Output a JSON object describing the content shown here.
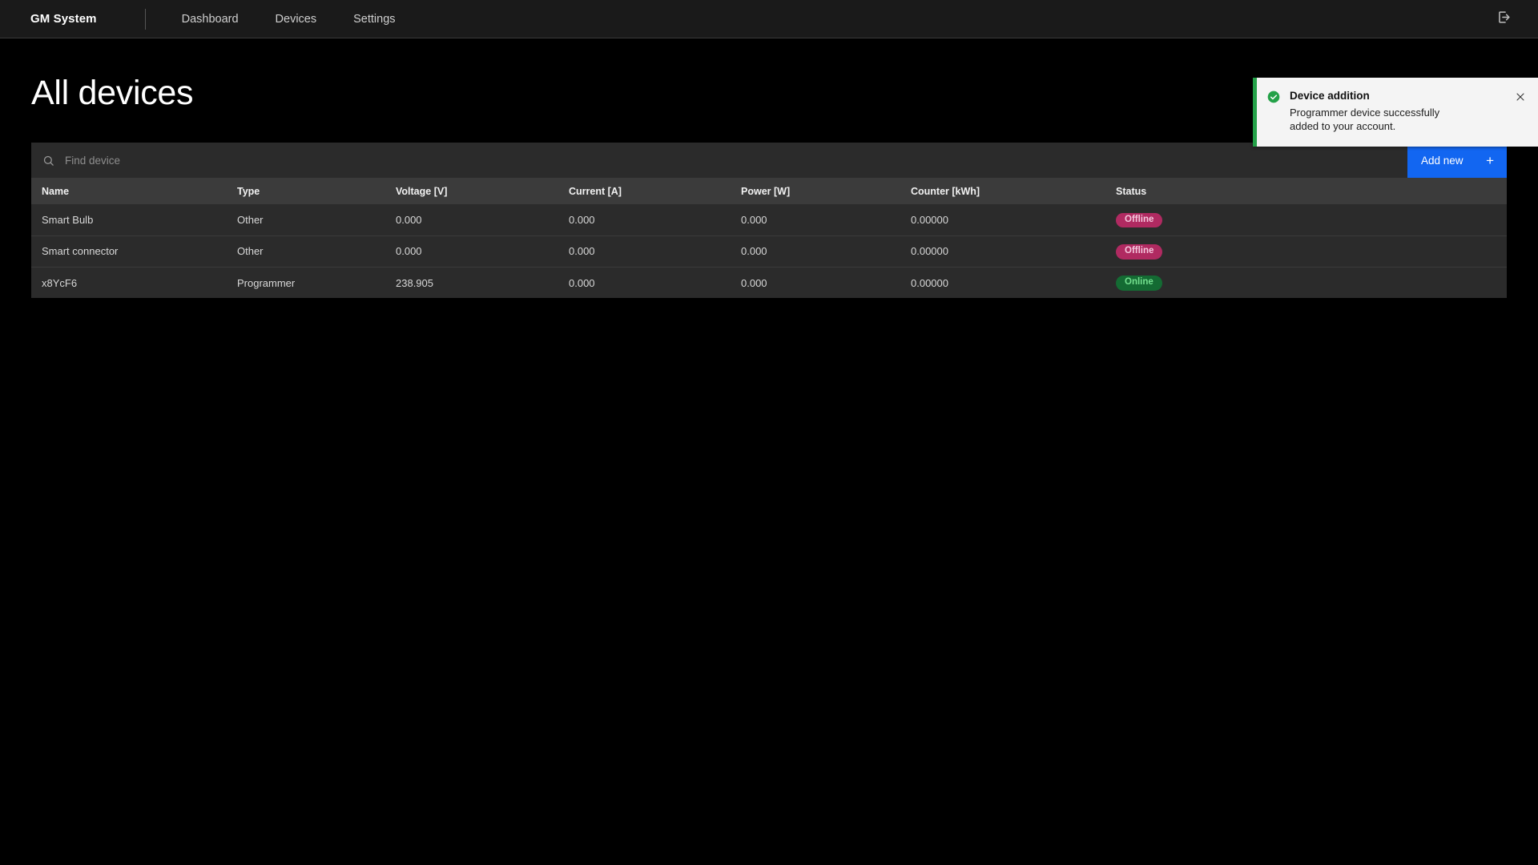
{
  "navbar": {
    "brand": "GM System",
    "links": [
      {
        "label": "Dashboard",
        "name": "nav-link-dashboard"
      },
      {
        "label": "Devices",
        "name": "nav-link-devices"
      },
      {
        "label": "Settings",
        "name": "nav-link-settings"
      }
    ],
    "logout_icon": "logout-icon"
  },
  "page": {
    "title": "All devices"
  },
  "toolbar": {
    "search_placeholder": "Find device",
    "search_value": "",
    "search_icon": "search-icon",
    "add_new_label": "Add new",
    "add_new_plus": "+",
    "accent_color": "#1266f1"
  },
  "table": {
    "columns": [
      "Name",
      "Type",
      "Voltage [V]",
      "Current [A]",
      "Power [W]",
      "Counter [kWh]",
      "Status"
    ],
    "rows": [
      {
        "name": "Smart Bulb",
        "type": "Other",
        "voltage": "0.000",
        "current": "0.000",
        "power": "0.000",
        "counter": "0.00000",
        "status": "Offline",
        "status_kind": "offline"
      },
      {
        "name": "Smart connector",
        "type": "Other",
        "voltage": "0.000",
        "current": "0.000",
        "power": "0.000",
        "counter": "0.00000",
        "status": "Offline",
        "status_kind": "offline"
      },
      {
        "name": "x8YcF6",
        "type": "Programmer",
        "voltage": "238.905",
        "current": "0.000",
        "power": "0.000",
        "counter": "0.00000",
        "status": "Online",
        "status_kind": "online"
      }
    ],
    "status_colors": {
      "offline_bg": "#b02a61",
      "offline_text": "#f4c7dd",
      "online_bg": "#146b33",
      "online_text": "#73e08e"
    }
  },
  "toast": {
    "title": "Device addition",
    "message": "Programmer device successfully added to your account.",
    "icon": "check-circle-icon",
    "close_icon": "close-icon",
    "accent_color": "#24a148"
  }
}
